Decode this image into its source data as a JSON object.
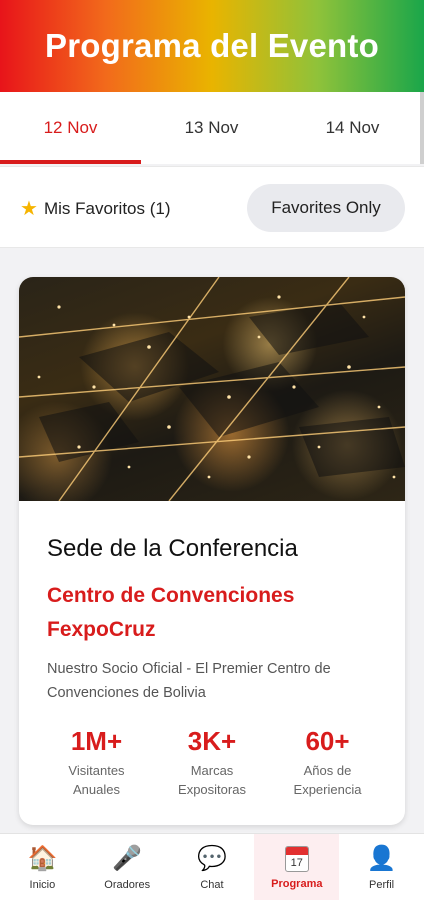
{
  "header": {
    "title": "Programa del Evento"
  },
  "tabs": [
    {
      "label": "12 Nov",
      "active": true
    },
    {
      "label": "13 Nov",
      "active": false
    },
    {
      "label": "14 Nov",
      "active": false
    }
  ],
  "favorites": {
    "label": "Mis Favoritos (1)",
    "icon": "star-icon",
    "toggle_label": "Favorites Only"
  },
  "venue_card": {
    "title": "Sede de la Conferencia",
    "venue_line1": "Centro de Convenciones",
    "venue_line2": "FexpoCruz",
    "description": "Nuestro Socio Oficial - El Premier Centro de Convenciones de Bolivia",
    "stats": [
      {
        "value": "1M+",
        "label_line1": "Visitantes",
        "label_line2": "Anuales"
      },
      {
        "value": "3K+",
        "label_line1": "Marcas",
        "label_line2": "Expositoras"
      },
      {
        "value": "60+",
        "label_line1": "Años de",
        "label_line2": "Experiencia"
      }
    ]
  },
  "bottom_nav": [
    {
      "label": "Inicio",
      "icon": "home-icon",
      "glyph": "🏠"
    },
    {
      "label": "Oradores",
      "icon": "microphone-icon",
      "glyph": "🎤"
    },
    {
      "label": "Chat",
      "icon": "chat-bubble-icon",
      "glyph": "💬"
    },
    {
      "label": "Programa",
      "icon": "calendar-icon",
      "glyph": "17",
      "active": true
    },
    {
      "label": "Perfil",
      "icon": "user-icon",
      "glyph": "👤"
    }
  ],
  "colors": {
    "accent": "#d81c1c",
    "favorites_chip": "#e9eaee",
    "star": "#f6b400"
  }
}
